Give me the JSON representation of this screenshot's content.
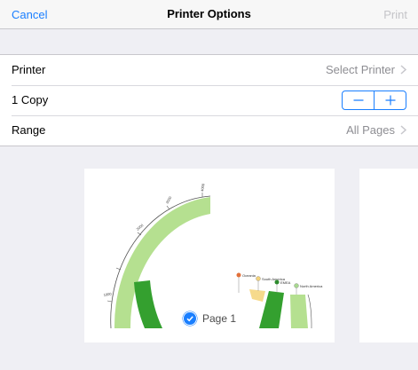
{
  "nav": {
    "cancel": "Cancel",
    "title": "Printer Options",
    "print": "Print"
  },
  "options": {
    "printer": {
      "label": "Printer",
      "value": "Select Printer"
    },
    "copies": {
      "label": "1 Copy",
      "minus": "−",
      "plus": "+"
    },
    "range": {
      "label": "Range",
      "value": "All Pages"
    }
  },
  "preview": {
    "page_label": "Page 1",
    "tick_labels": [
      "4000",
      "3000",
      "2000",
      "1000"
    ],
    "annotations": [
      {
        "label": "Oceania",
        "color": "#e2703a"
      },
      {
        "label": "South America",
        "color": "#f2d27a"
      },
      {
        "label": "EMEA",
        "color": "#2e8b2e"
      },
      {
        "label": "North America",
        "color": "#a8d890"
      }
    ]
  },
  "colors": {
    "accent": "#1a7fff",
    "light_green": "#b5e090",
    "dark_green": "#34a02f",
    "yellow": "#f6da8c"
  }
}
